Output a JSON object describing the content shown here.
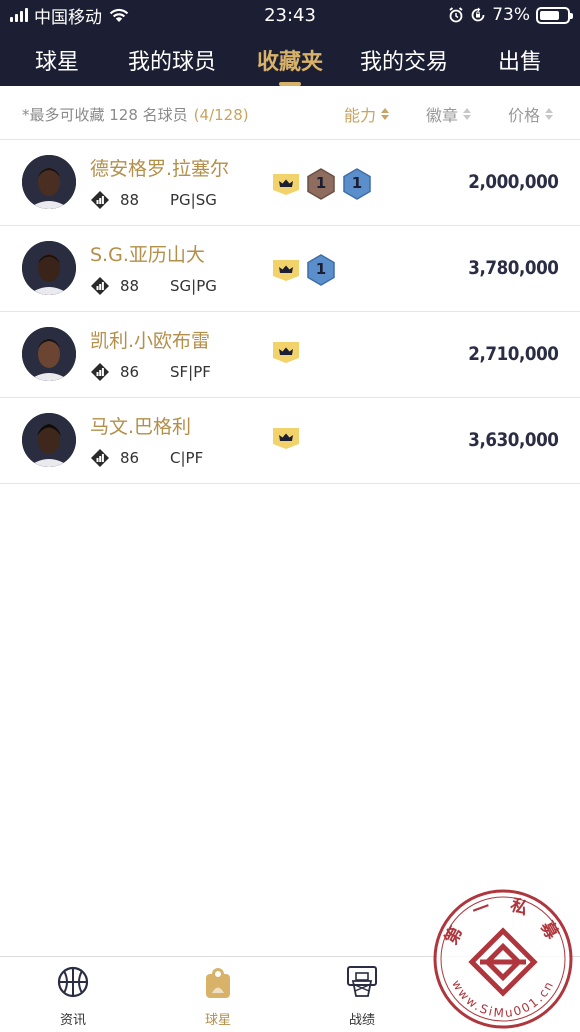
{
  "status_bar": {
    "carrier": "中国移动",
    "time": "23:43",
    "battery_percent": "73%",
    "battery_level": 0.73
  },
  "tabs": [
    {
      "label": "球星",
      "active": false
    },
    {
      "label": "我的球员",
      "active": false
    },
    {
      "label": "收藏夹",
      "active": true
    },
    {
      "label": "我的交易",
      "active": false
    },
    {
      "label": "出售",
      "active": false
    }
  ],
  "sortbar": {
    "note": "*最多可收藏 128 名球员",
    "count": "(4/128)",
    "sort_options": [
      {
        "label": "能力",
        "active": true
      },
      {
        "label": "徽章",
        "active": false
      },
      {
        "label": "价格",
        "active": false
      }
    ]
  },
  "players": [
    {
      "name": "德安格罗.拉塞尔",
      "rating": "88",
      "positions": "PG|SG",
      "badges": [
        "crown",
        "bronze-1",
        "blue-1"
      ],
      "badge_numbers": [
        "1",
        "1"
      ],
      "price": "2,000,000"
    },
    {
      "name": "S.G.亚历山大",
      "rating": "88",
      "positions": "SG|PG",
      "badges": [
        "crown",
        "blue-1"
      ],
      "badge_numbers": [
        "1"
      ],
      "price": "3,780,000"
    },
    {
      "name": "凯利.小欧布雷",
      "rating": "86",
      "positions": "SF|PF",
      "badges": [
        "crown"
      ],
      "badge_numbers": [],
      "price": "2,710,000"
    },
    {
      "name": "马文.巴格利",
      "rating": "86",
      "positions": "C|PF",
      "badges": [
        "crown"
      ],
      "badge_numbers": [],
      "price": "3,630,000"
    }
  ],
  "bottom_nav": [
    {
      "label": "资讯",
      "icon": "basketball-icon",
      "active": false
    },
    {
      "label": "球星",
      "icon": "player-card-icon",
      "active": true
    },
    {
      "label": "战绩",
      "icon": "hoop-icon",
      "active": false
    }
  ],
  "watermark": {
    "text_top": "第 一 私 募",
    "text_bottom": "www.SiMu001.cn"
  },
  "colors": {
    "header_bg": "#1c1f33",
    "accent_gold": "#d9b26a",
    "name_gold": "#b48f4a",
    "price_navy": "#2a2d44",
    "badge_bronze": "#8e6d5e",
    "badge_blue": "#5b8fcc",
    "crown_yellow": "#f2d36b",
    "watermark_red": "#a8252c"
  }
}
